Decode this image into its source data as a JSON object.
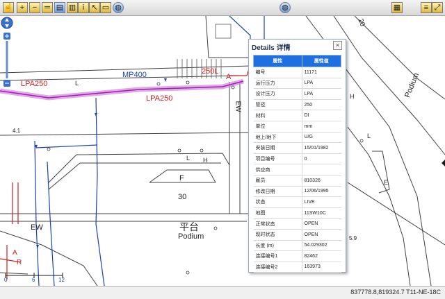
{
  "toolbar": {
    "left_tools": [
      "pan-tool",
      "zoom-in-tool",
      "zoom-out-tool",
      "measure-tool",
      "layers-tool",
      "legend-tool",
      "identify-tool",
      "select-tool",
      "print-tool",
      "globe-tool"
    ],
    "center_tool": "globe-tool",
    "right_tools": [
      "overview-tool",
      "menu-tool",
      "fullscreen-tool"
    ]
  },
  "map": {
    "labels": {
      "mp400": "MP400",
      "lpa250_left": "LPA250",
      "lpa250_center": "LPA250",
      "lpa250_top": "250L",
      "letter_a": "A",
      "letter_l_top": "L",
      "letter_l_mid": "L",
      "letter_h_mid": "H",
      "letter_f": "F",
      "num_30": "30",
      "podium_zh": "平台",
      "podium_en": "Podium",
      "podium_right": "Podium",
      "ew_left": "EW",
      "ew_mid": "EW",
      "num_20": "20",
      "num_4_1": "4.1",
      "num_5_9": "5.9",
      "letter_h_right": "H",
      "letter_l_right": "L",
      "letter_e_right": "E",
      "letter_r": "R",
      "letter_a_left": "A",
      "scale_0": "0",
      "scale_6": "6",
      "scale_12": "12"
    }
  },
  "popup": {
    "title": "Details 详情",
    "close_label": "×",
    "headers": [
      "属性",
      "属性值"
    ],
    "rows": [
      [
        "编号",
        "11171"
      ],
      [
        "运行压力",
        "LPA"
      ],
      [
        "设计压力",
        "LPA"
      ],
      [
        "管径",
        "250"
      ],
      [
        "材料",
        "DI"
      ],
      [
        "单位",
        "mm"
      ],
      [
        "地上/地下",
        "U/G"
      ],
      [
        "安装日期",
        "15/01/1982"
      ],
      [
        "项目编号",
        "0"
      ],
      [
        "供应商",
        ""
      ],
      [
        "雇员",
        "810326"
      ],
      [
        "修改日期",
        "12/06/1995"
      ],
      [
        "状态",
        "LIVE"
      ],
      [
        "地图",
        "11SW10C"
      ],
      [
        "正常状态",
        "OPEN"
      ],
      [
        "现时状态",
        "OPEN"
      ],
      [
        "长度 (m)",
        "54.029302"
      ],
      [
        "连接编号1",
        "82462"
      ],
      [
        "连接编号2",
        "163973"
      ]
    ]
  },
  "status": {
    "coordinates": "837778.8,819324.7 T11-NE-18C"
  }
}
